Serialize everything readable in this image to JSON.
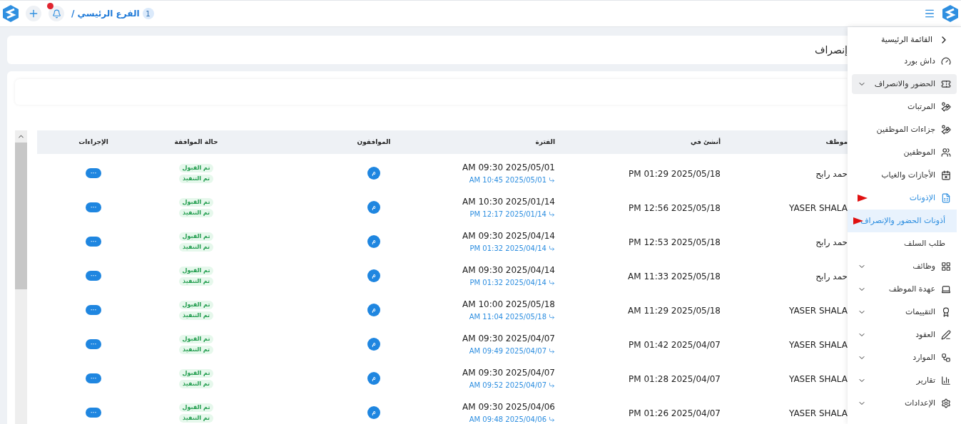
{
  "top_bar": {
    "branch_count": "1",
    "breadcrumb": "الفرع الرئيسي /"
  },
  "page_title": "إنصراف",
  "table": {
    "columns": [
      "موظف",
      "أنشئ في",
      "الفترة",
      "الموافقون",
      "حالة الموافقة",
      "الإجراءات"
    ],
    "rows": [
      {
        "employee": "حمد رابح",
        "created_at": "PM 01:29 2025/05/18",
        "period_start": "AM 09:30 2025/05/01",
        "period_end": "AM 10:45 2025/05/01",
        "approver": "م",
        "statuses": [
          "تم القبول",
          "تم التنفيذ"
        ],
        "action": "···"
      },
      {
        "employee": "YASER SHALA",
        "created_at": "PM 12:56 2025/05/18",
        "period_start": "AM 10:30 2025/01/14",
        "period_end": "PM 12:17 2025/01/14",
        "approver": "م",
        "statuses": [
          "تم القبول",
          "تم التنفيذ"
        ],
        "action": "···"
      },
      {
        "employee": "حمد رابح",
        "created_at": "PM 12:53 2025/05/18",
        "period_start": "AM 09:30 2025/04/14",
        "period_end": "PM 01:32 2025/04/14",
        "approver": "م",
        "statuses": [
          "تم القبول",
          "تم التنفيذ"
        ],
        "action": "···"
      },
      {
        "employee": "حمد رابح",
        "created_at": "AM 11:33 2025/05/18",
        "period_start": "AM 09:30 2025/04/14",
        "period_end": "PM 01:32 2025/04/14",
        "approver": "م",
        "statuses": [
          "تم القبول",
          "تم التنفيذ"
        ],
        "action": "···"
      },
      {
        "employee": "YASER SHALA",
        "created_at": "AM 11:29 2025/05/18",
        "period_start": "AM 10:00 2025/05/18",
        "period_end": "AM 11:04 2025/05/18",
        "approver": "م",
        "statuses": [
          "تم القبول",
          "تم التنفيذ"
        ],
        "action": "···"
      },
      {
        "employee": "YASER SHALA",
        "created_at": "PM 01:42 2025/04/07",
        "period_start": "AM 09:30 2025/04/07",
        "period_end": "AM 09:49 2025/04/07",
        "approver": "م",
        "statuses": [
          "تم القبول",
          "تم التنفيذ"
        ],
        "action": "···"
      },
      {
        "employee": "YASER SHALA",
        "created_at": "PM 01:28 2025/04/07",
        "period_start": "AM 09:30 2025/04/07",
        "period_end": "AM 09:52 2025/04/07",
        "approver": "م",
        "statuses": [
          "تم القبول",
          "تم التنفيذ"
        ],
        "action": "···"
      },
      {
        "employee": "YASER SHALA",
        "created_at": "PM 01:26 2025/04/07",
        "period_start": "AM 09:30 2025/04/06",
        "period_end": "AM 09:48 2025/04/06",
        "approver": "م",
        "statuses": [
          "تم القبول",
          "تم التنفيذ"
        ],
        "action": "···"
      }
    ]
  },
  "sidebar": {
    "back": "القائمة الرئيسية",
    "items": [
      {
        "label": "داش بورد",
        "kind": "link",
        "highlighted": false,
        "selected": false
      },
      {
        "label": "الحضور والانصراف",
        "kind": "group",
        "highlighted": true,
        "selected": false
      },
      {
        "label": "المرتبات",
        "kind": "link",
        "highlighted": false,
        "selected": false
      },
      {
        "label": "جزاءات الموظفين",
        "kind": "link",
        "highlighted": false,
        "selected": false
      },
      {
        "label": "الموظفين",
        "kind": "link",
        "highlighted": false,
        "selected": false
      },
      {
        "label": "الأجازات والغياب",
        "kind": "link",
        "highlighted": false,
        "selected": false
      },
      {
        "label": "الإذونات",
        "kind": "link",
        "highlighted": false,
        "selected": true,
        "children": [
          {
            "label": "أذونات الحضور والإنصراف",
            "selected": true
          },
          {
            "label": "طلب السلف",
            "selected": false
          }
        ]
      },
      {
        "label": "وظائف",
        "kind": "group",
        "highlighted": false,
        "selected": false
      },
      {
        "label": "عهدة الموظف",
        "kind": "group",
        "highlighted": false,
        "selected": false
      },
      {
        "label": "التقييمات",
        "kind": "group",
        "highlighted": false,
        "selected": false
      },
      {
        "label": "العقود",
        "kind": "group",
        "highlighted": false,
        "selected": false
      },
      {
        "label": "الموارد",
        "kind": "group",
        "highlighted": false,
        "selected": false
      },
      {
        "label": "تقارير",
        "kind": "group",
        "highlighted": false,
        "selected": false
      },
      {
        "label": "الإعدادات",
        "kind": "group",
        "highlighted": false,
        "selected": false
      }
    ]
  }
}
